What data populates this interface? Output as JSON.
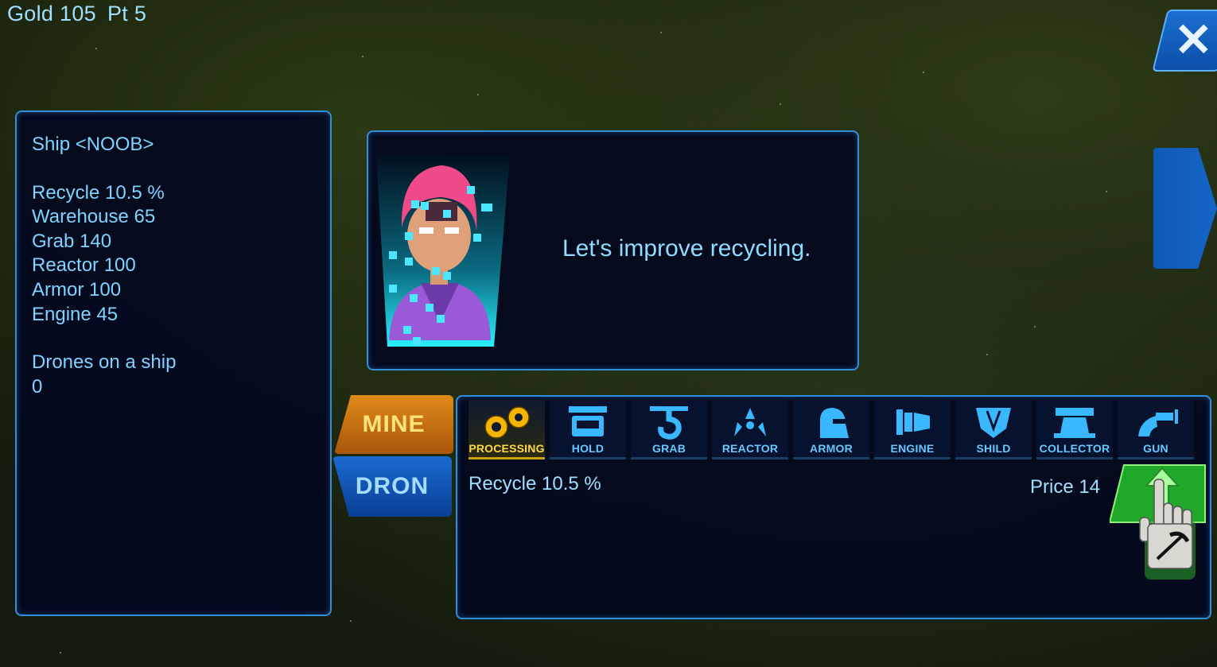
{
  "hud": {
    "gold": "Gold 105",
    "pt": "Pt 5"
  },
  "close_icon": "close-x-icon",
  "next_icon": "arrow-right-icon",
  "ship": {
    "title": "Ship <NOOB>",
    "stats": [
      "Recycle 10.5 %",
      "Warehouse 65",
      "Grab 140",
      "Reactor 100",
      "Armor 100",
      "Engine 45"
    ],
    "drones_label": "Drones on a ship",
    "drones_value": "0"
  },
  "dialog": {
    "text": "Let's improve recycling."
  },
  "modes": {
    "mine": "MINE",
    "dron": "DRON"
  },
  "tabs": [
    {
      "label": "PROCESSING",
      "icon": "gears-icon"
    },
    {
      "label": "HOLD",
      "icon": "crate-icon"
    },
    {
      "label": "GRAB",
      "icon": "hook-icon"
    },
    {
      "label": "REACTOR",
      "icon": "radiation-icon"
    },
    {
      "label": "ARMOR",
      "icon": "helmet-icon"
    },
    {
      "label": "ENGINE",
      "icon": "thruster-icon"
    },
    {
      "label": "SHILD",
      "icon": "shield-icon"
    },
    {
      "label": "COLLECTOR",
      "icon": "collector-icon"
    },
    {
      "label": "GUN",
      "icon": "gun-icon"
    }
  ],
  "selected": {
    "info": "Recycle 10.5 %",
    "price": "Price 14"
  },
  "colors": {
    "accent_text": "#7fd4ff",
    "panel_border": "#2f8fd8",
    "mine": "#e08a1a",
    "dron": "#1a6ad0",
    "upgrade": "#1fa82a"
  }
}
